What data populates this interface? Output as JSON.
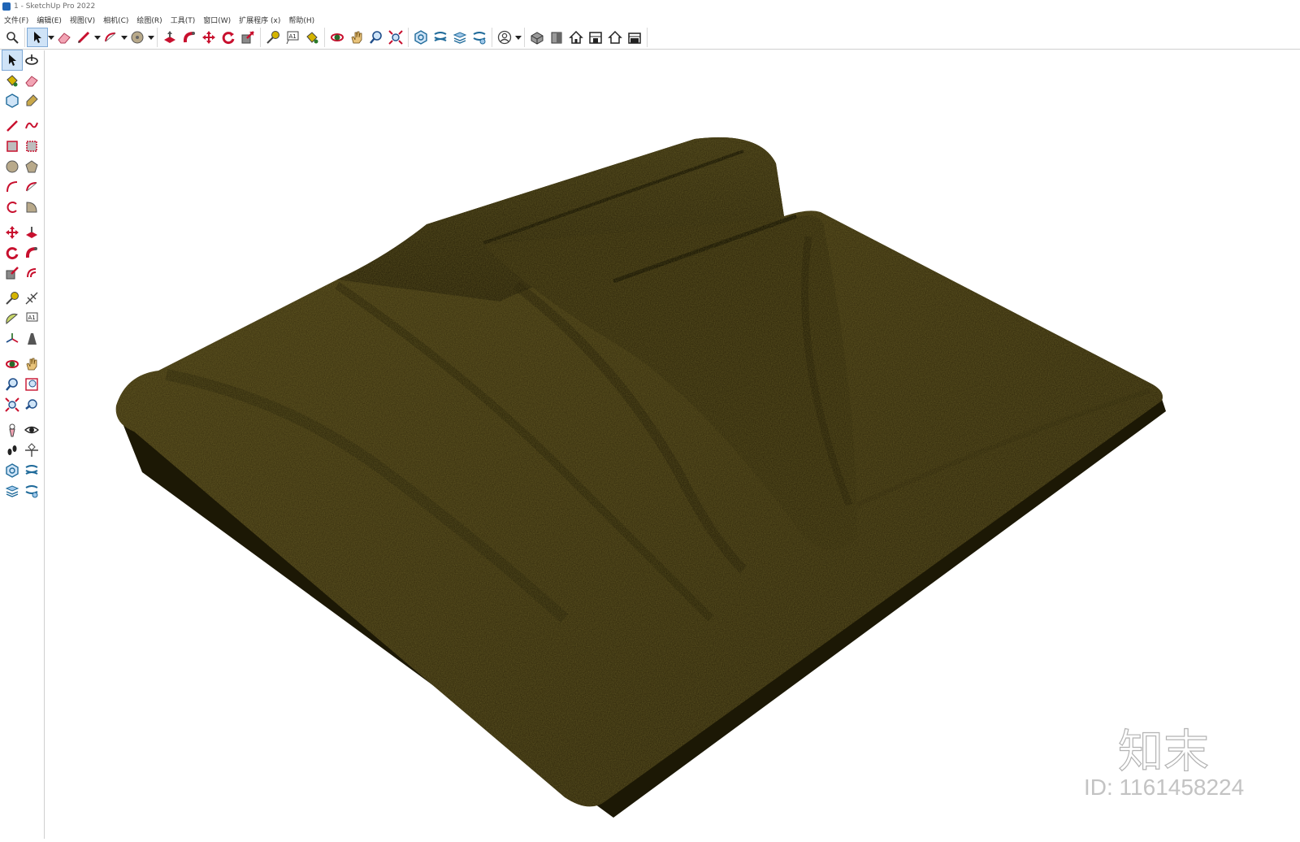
{
  "window": {
    "title": "1 - SketchUp Pro 2022"
  },
  "menu": [
    {
      "label": "文件(F)"
    },
    {
      "label": "编辑(E)"
    },
    {
      "label": "视图(V)"
    },
    {
      "label": "相机(C)"
    },
    {
      "label": "绘图(R)"
    },
    {
      "label": "工具(T)"
    },
    {
      "label": "窗口(W)"
    },
    {
      "label": "扩展程序 (x)"
    },
    {
      "label": "帮助(H)"
    }
  ],
  "toolbar": {
    "tools": [
      "search-icon",
      "select-icon",
      "eraser-icon",
      "pencil-icon",
      "arc-icon",
      "circle-icon",
      "push-pull-icon",
      "follow-me-icon",
      "move-icon",
      "rotate-icon",
      "scale-icon",
      "tape-measure-icon",
      "text-icon",
      "paint-bucket-icon",
      "orbit-icon",
      "pan-icon",
      "zoom-icon",
      "zoom-extents-icon",
      "component-icon",
      "section-icon",
      "layers-icon",
      "styles-icon",
      "account-icon",
      "iso-view-icon",
      "front-view-icon",
      "top-view-icon",
      "right-view-icon",
      "left-view-icon",
      "back-view-icon"
    ]
  },
  "watermark": {
    "logo_text": "知末",
    "id_text": "ID: 1161458224"
  },
  "colors": {
    "fabric": "#3b3210",
    "fabric_shadow": "#1f1a07",
    "accent": "#c8102e"
  }
}
